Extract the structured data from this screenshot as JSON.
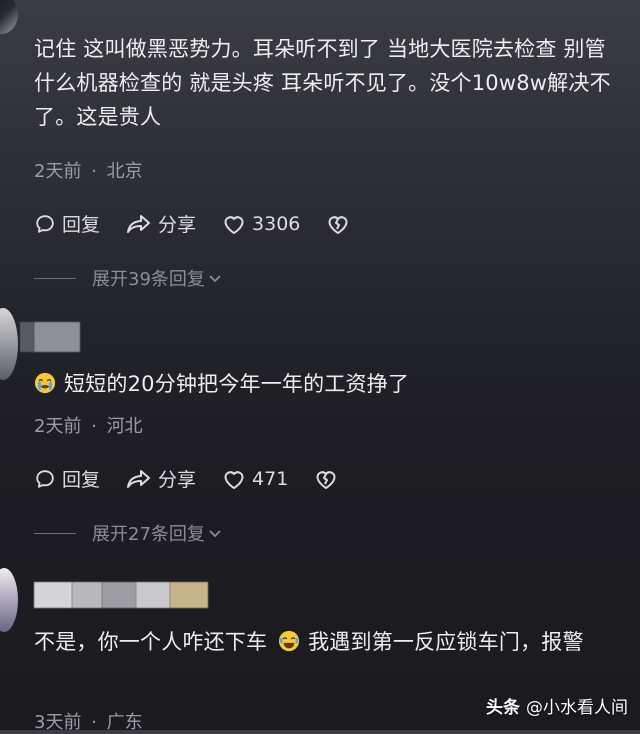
{
  "comments": [
    {
      "text": "记住 这叫做黑恶势力。耳朵听不到了 当地大医院去检查 别管什么机器检查的 就是头疼 耳朵听不见了。没个10w8w解决不了。这是贵人",
      "time": "2天前",
      "separator": "·",
      "location": "北京",
      "reply_label": "回复",
      "share_label": "分享",
      "like_count": "3306",
      "expand_label": "展开39条回复"
    },
    {
      "emoji": "loudly-crying-face",
      "text": "短短的20分钟把今年一年的工资挣了",
      "time": "2天前",
      "separator": "·",
      "location": "河北",
      "reply_label": "回复",
      "share_label": "分享",
      "like_count": "471",
      "expand_label": "展开27条回复"
    },
    {
      "text_before_emoji": "不是，你一个人咋还下车",
      "emoji": "face-with-tears-of-joy",
      "text_after_emoji": "我遇到第一反应锁车门，报警",
      "time": "3天前",
      "separator": "·",
      "location": "广东"
    }
  ],
  "watermark": {
    "brand": "头条",
    "account": "@小水看人间"
  },
  "colors": {
    "text": "#eeeef1",
    "meta": "#9b9ca6",
    "icon": "#dcdce2"
  }
}
